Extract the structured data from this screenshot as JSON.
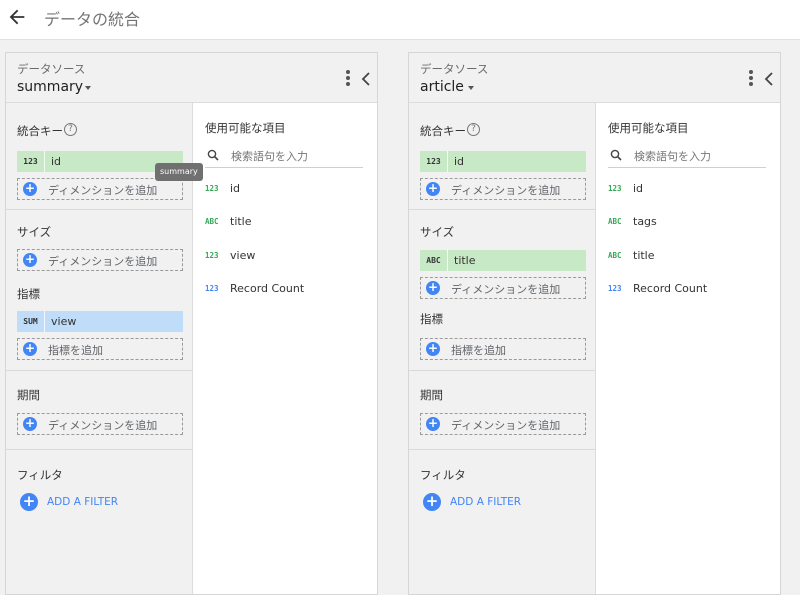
{
  "header": {
    "title": "データの統合",
    "back_icon": "arrow-back-icon"
  },
  "labels": {
    "datasource": "データソース",
    "join_key": "統合キー",
    "help": "?",
    "size": "サイズ",
    "metric": "指標",
    "period": "期間",
    "filter": "フィルタ",
    "add_dimension": "ディメンションを追加",
    "add_metric": "指標を追加",
    "add_filter": "ADD A FILTER",
    "available_fields": "使用可能な項目",
    "search_placeholder": "検索語句を入力",
    "plus": "+"
  },
  "colors": {
    "accent": "#4285f4",
    "dimension_chip": "#c7e9c5",
    "metric_chip": "#bfdcf8",
    "number_type": "#34a853",
    "text_type": "#34a853",
    "metric_type": "#4285f4"
  },
  "panels": [
    {
      "source_name": "summary",
      "tooltip": "summary",
      "join_key": {
        "type": "123",
        "name": "id"
      },
      "size_dims": [],
      "metrics": [
        {
          "type": "SUM",
          "name": "view"
        }
      ],
      "fields": [
        {
          "type": "123",
          "name": "id"
        },
        {
          "type": "ABC",
          "name": "title"
        },
        {
          "type": "123",
          "name": "view"
        },
        {
          "type": "123",
          "name": "Record Count"
        }
      ]
    },
    {
      "source_name": "article",
      "join_key": {
        "type": "123",
        "name": "id"
      },
      "size_dims": [
        {
          "type": "ABC",
          "name": "title"
        }
      ],
      "metrics": [],
      "fields": [
        {
          "type": "123",
          "name": "id"
        },
        {
          "type": "ABC",
          "name": "tags"
        },
        {
          "type": "ABC",
          "name": "title"
        },
        {
          "type": "123",
          "name": "Record Count"
        }
      ]
    }
  ]
}
